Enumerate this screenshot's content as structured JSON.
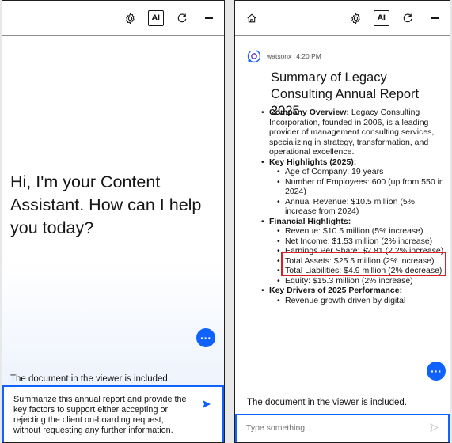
{
  "left_panel": {
    "greeting": "Hi, I'm your Content Assistant. How can I help you today?",
    "doc_note": "The document in the viewer is included.",
    "prompt_text": "Summarize this annual report and provide the key factors to support either accepting or rejecting the client on-boarding request, without requesting any further information.",
    "fab_label": "···",
    "toolbar_ai": "AI"
  },
  "right_panel": {
    "toolbar_ai": "AI",
    "sender": "watsonx",
    "time": "4:20 PM",
    "title": "Summary of Legacy Consulting Annual Report 2025",
    "company_overview_label": "Company Overview:",
    "company_overview_text": " Legacy Consulting Incorporation, founded in 2006, is a leading provider of management consulting services, specializing in strategy, transformation, and operational excellence.",
    "key_highlights_label": "Key Highlights (2025):",
    "key_highlights": [
      "Age of Company: 19 years",
      "Number of Employees: 600 (up from 550 in 2024)",
      "Annual Revenue: $10.5 million (5% increase from 2024)"
    ],
    "financial_label": "Financial Highlights:",
    "financial": [
      "Revenue: $10.5 million (5% increase)",
      "Net Income: $1.53 million (2% increase)",
      "Earnings Per Share: $2.81 (2.2% increase)",
      "Total Assets: $25.5 million (2% increase)",
      "Total Liabilities: $4.9 million (2% decrease)",
      "Equity: $15.3 million (2% increase)"
    ],
    "drivers_label": "Key Drivers of 2025 Performance:",
    "drivers": [
      "Revenue growth driven by digital"
    ],
    "doc_note": "The document in the viewer is included.",
    "input_placeholder": "Type something...",
    "fab_label": "···",
    "highlight_color": "#da1e28",
    "accent_color": "#0f62fe"
  }
}
